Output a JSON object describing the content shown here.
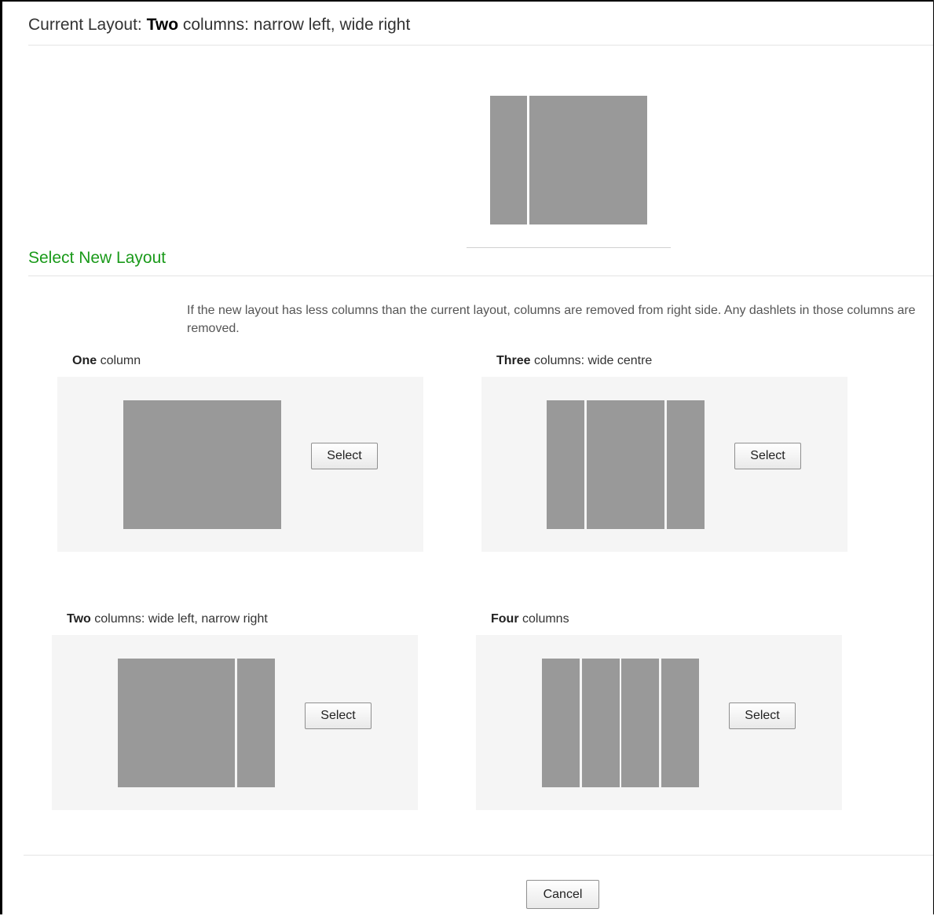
{
  "current": {
    "prefix": "Current Layout:",
    "bold": "Two",
    "rest": "columns: narrow left, wide right"
  },
  "select_title": "Select New Layout",
  "info_text": "If the new layout has less columns than the current layout, columns are removed from right side. Any dashlets in those columns are removed.",
  "options": [
    {
      "bold": "One",
      "rest": "column",
      "button": "Select"
    },
    {
      "bold": "Three",
      "rest": "columns: wide centre",
      "button": "Select"
    },
    {
      "bold": "Two",
      "rest": "columns: wide left, narrow right",
      "button": "Select"
    },
    {
      "bold": "Four",
      "rest": "columns",
      "button": "Select"
    }
  ],
  "cancel_label": "Cancel",
  "colors": {
    "accent_green": "#1a9a1a",
    "column_gray": "#999999",
    "panel_bg": "#f5f5f5"
  }
}
